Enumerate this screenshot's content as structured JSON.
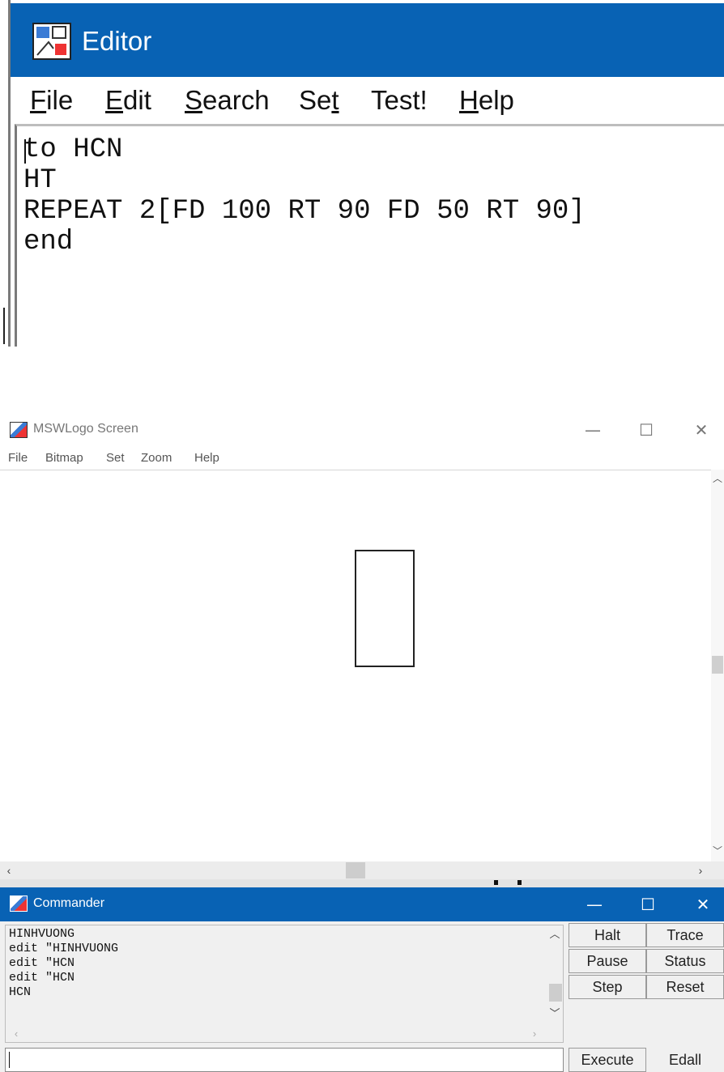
{
  "editor": {
    "title": "Editor",
    "menu": [
      {
        "pre": "",
        "u": "F",
        "post": "ile"
      },
      {
        "pre": "",
        "u": "E",
        "post": "dit"
      },
      {
        "pre": "",
        "u": "S",
        "post": "earch"
      },
      {
        "pre": "Se",
        "u": "t",
        "post": ""
      },
      {
        "pre": "Test!",
        "u": "",
        "post": ""
      },
      {
        "pre": "",
        "u": "H",
        "post": "elp"
      }
    ],
    "code": [
      "to HCN",
      "HT",
      "REPEAT 2[FD 100 RT 90 FD 50 RT 90]",
      "end"
    ]
  },
  "logo_screen": {
    "title": "MSWLogo Screen",
    "menu": [
      "File",
      "Bitmap",
      "Set",
      "Zoom",
      "Help"
    ],
    "controls": {
      "minimize": "—",
      "maximize": "☐",
      "close": "✕"
    }
  },
  "commander": {
    "title": "Commander",
    "controls": {
      "minimize": "—",
      "maximize": "☐",
      "close": "✕"
    },
    "history": [
      "HINHVUONG",
      "edit \"HINHVUONG",
      "edit \"HCN",
      "edit \"HCN",
      "HCN"
    ],
    "buttons": {
      "halt": "Halt",
      "trace": "Trace",
      "pause": "Pause",
      "status": "Status",
      "step": "Step",
      "reset": "Reset",
      "execute": "Execute",
      "edall": "Edall"
    },
    "input_value": ""
  }
}
